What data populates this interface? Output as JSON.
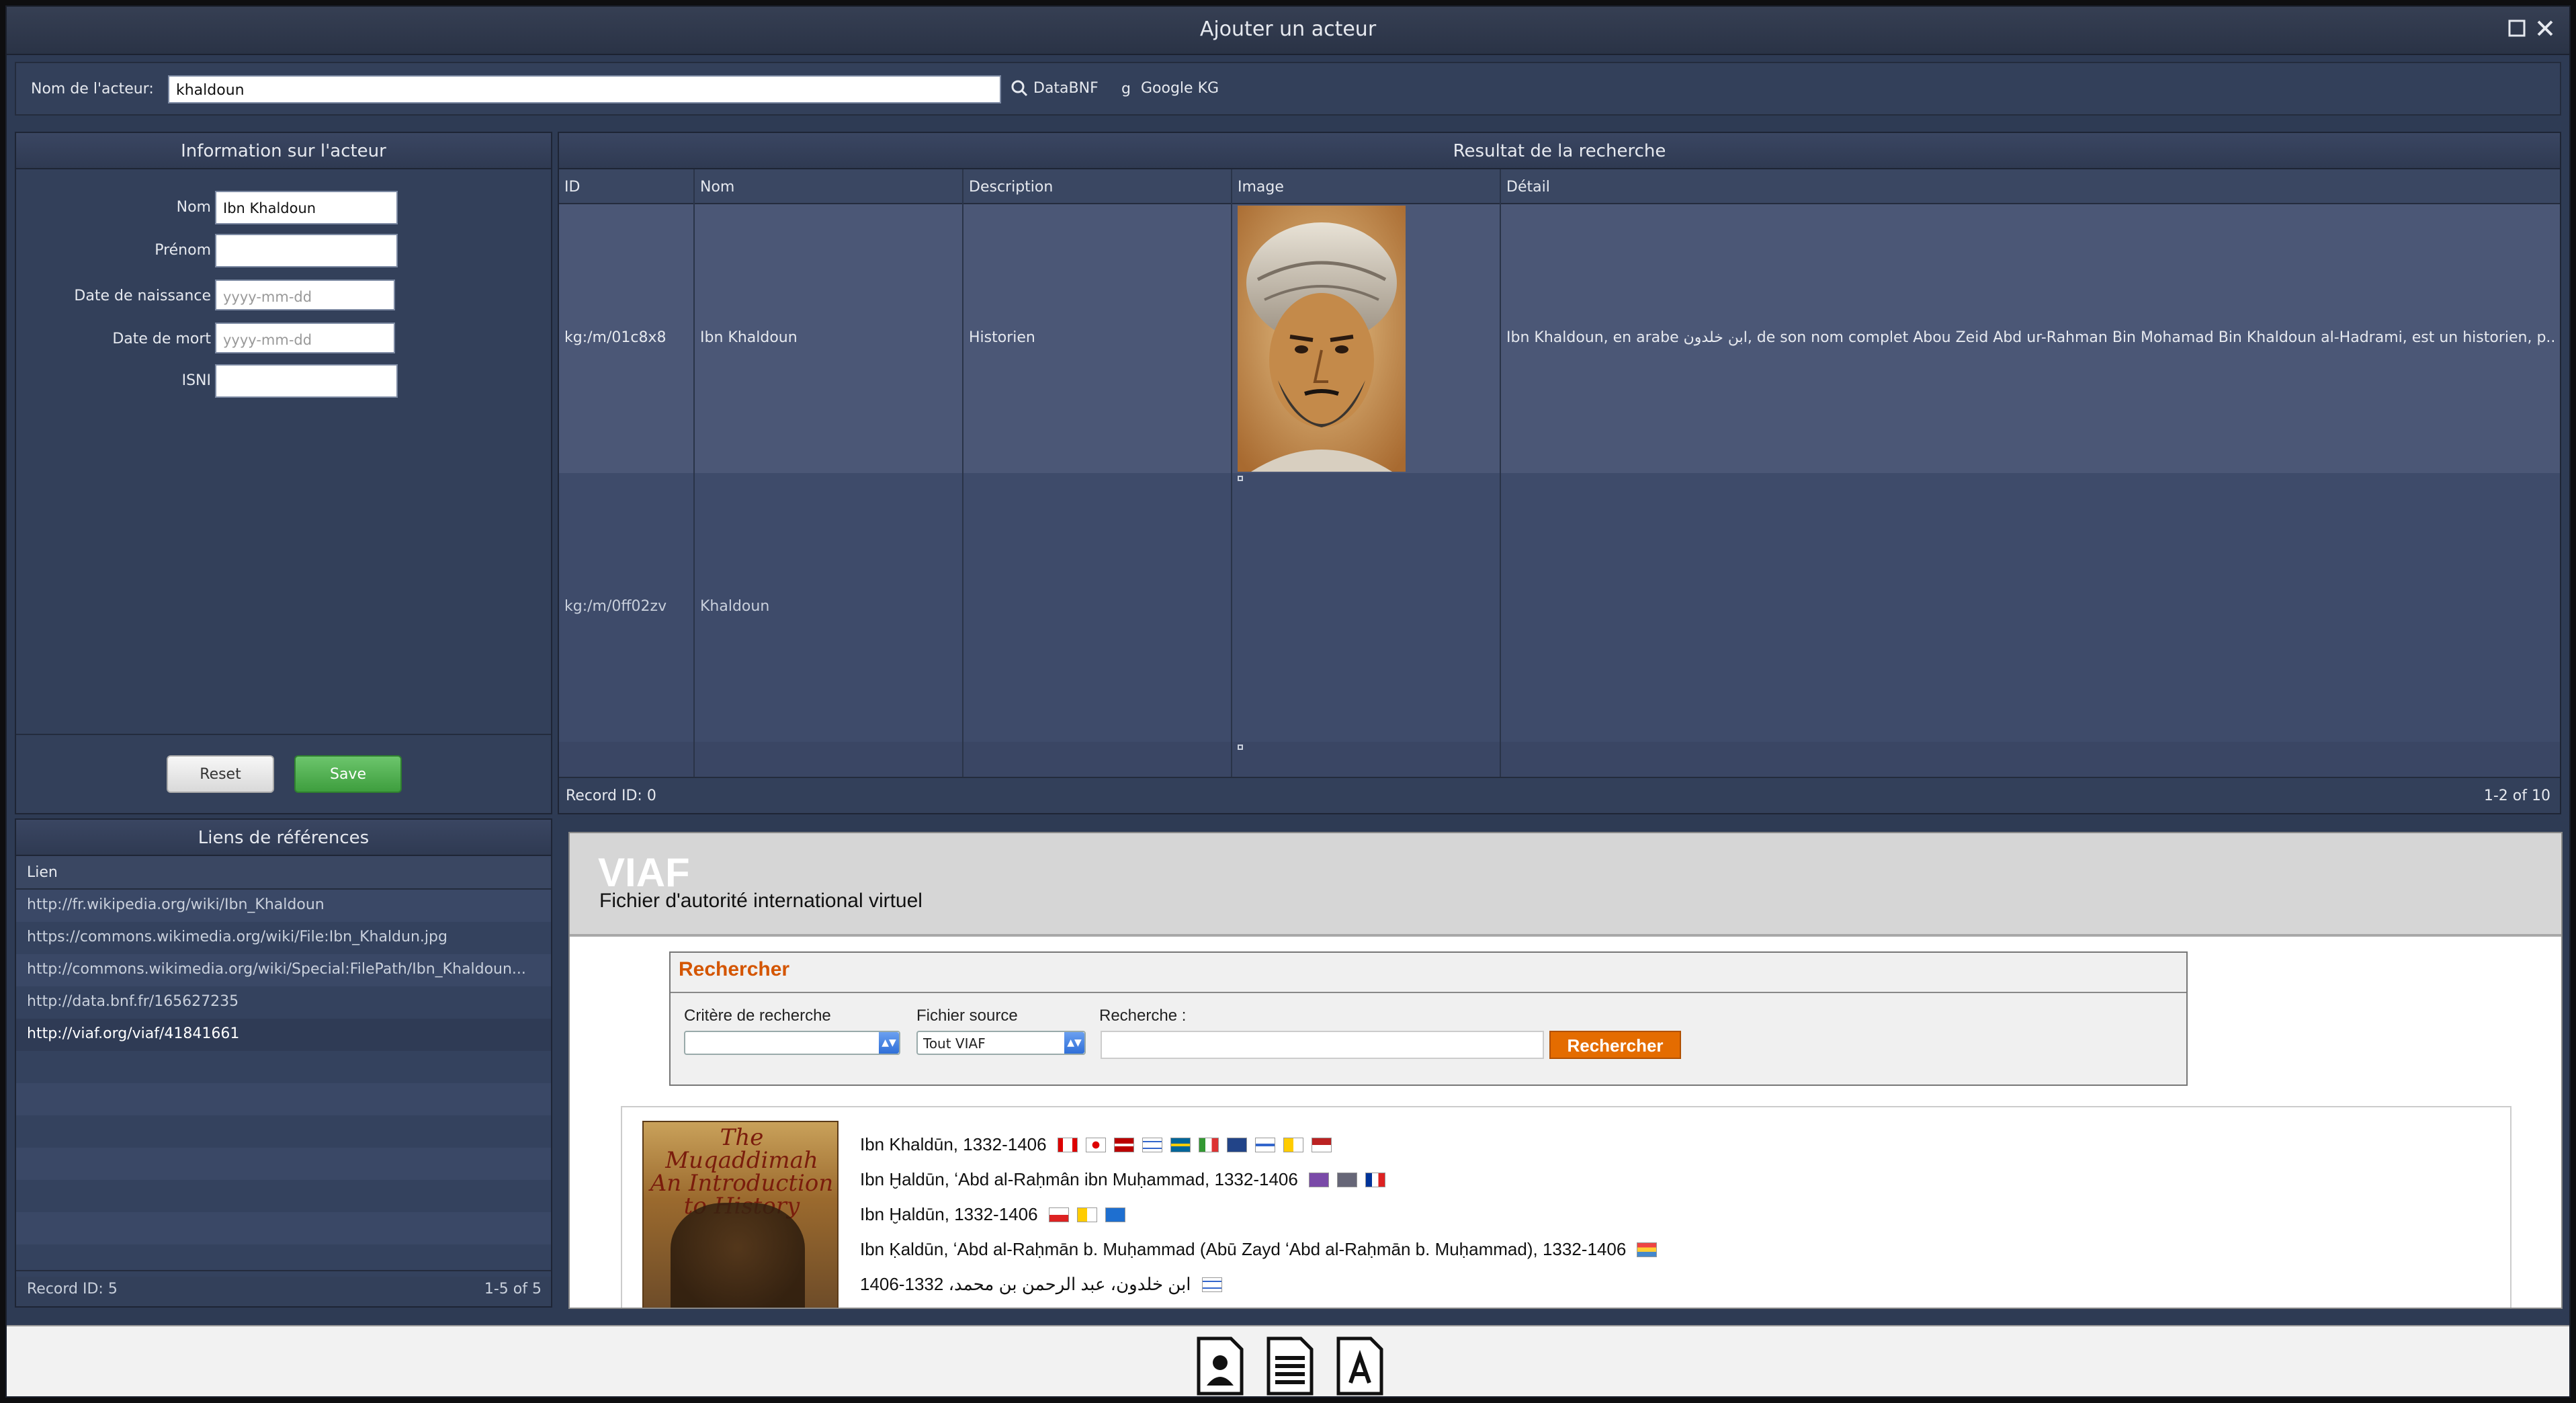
{
  "window": {
    "title": "Ajouter un acteur"
  },
  "search": {
    "label": "Nom de l'acteur:",
    "value": "khaldoun",
    "databnf": "DataBNF",
    "googlekg": "Google KG"
  },
  "info": {
    "title": "Information sur l'acteur",
    "fields": [
      {
        "label": "Nom",
        "value": "Ibn Khaldoun"
      },
      {
        "label": "Prénom",
        "value": ""
      },
      {
        "label": "Date de naissance",
        "placeholder": "yyyy-mm-dd"
      },
      {
        "label": "Date de mort",
        "placeholder": "yyyy-mm-dd"
      },
      {
        "label": "ISNI",
        "value": ""
      }
    ],
    "reset": "Reset",
    "save": "Save"
  },
  "results": {
    "title": "Resultat de la recherche",
    "columns": [
      "ID",
      "Nom",
      "Description",
      "Image",
      "Détail"
    ],
    "rows": [
      {
        "id": "kg:/m/01c8x8",
        "nom": "Ibn Khaldoun",
        "description": "Historien",
        "detail": "Ibn Khaldoun, en arabe ابن خلدون, de son nom complet Abou Zeid Abd ur-Rahman Bin Mohamad Bin Khaldoun al-Hadrami, est un historien, p..."
      },
      {
        "id": "kg:/m/0ff02zv",
        "nom": "Khaldoun",
        "description": "",
        "detail": ""
      }
    ],
    "record": "Record ID: 0",
    "count": "1-2 of 10"
  },
  "links": {
    "title": "Liens de références",
    "column": "Lien",
    "items": [
      "http://fr.wikipedia.org/wiki/Ibn_Khaldoun",
      "https://commons.wikimedia.org/wiki/File:Ibn_Khaldun.jpg",
      "http://commons.wikimedia.org/wiki/Special:FilePath/Ibn_Khaldoun...",
      "http://data.bnf.fr/165627235",
      "http://viaf.org/viaf/41841661"
    ],
    "record": "Record ID: 5",
    "count": "1-5 of 5"
  },
  "viaf": {
    "brand": "VIAF",
    "subtitle": "Fichier d'autorité international virtuel",
    "search_title": "Rechercher",
    "critere_label": "Critère de recherche",
    "fichier_label": "Fichier source",
    "fichier_value": "Tout VIAF",
    "recherche_label": "Recherche :",
    "button": "Rechercher",
    "book_title": "The Muqaddimah An Introduction to History",
    "entries": [
      "Ibn Khaldūn, 1332-1406",
      "Ibn Ḫaldūn, ʻAbd al-Raḥmân ibn Muḥammad, 1332-1406",
      "Ibn Ḫaldūn, 1332-1406",
      "Ibn Ḳaldūn, ʻAbd al-Raḥmān b. Muḥammad (Abū Zayd ʻAbd al-Raḥmān b. Muḥammad), 1332-1406",
      "ابن خلدون، عبد الرحمن بن محمد، 1332-1406"
    ]
  },
  "dock": {
    "icons": [
      "person-icon",
      "document-icon",
      "text-document-icon"
    ]
  }
}
